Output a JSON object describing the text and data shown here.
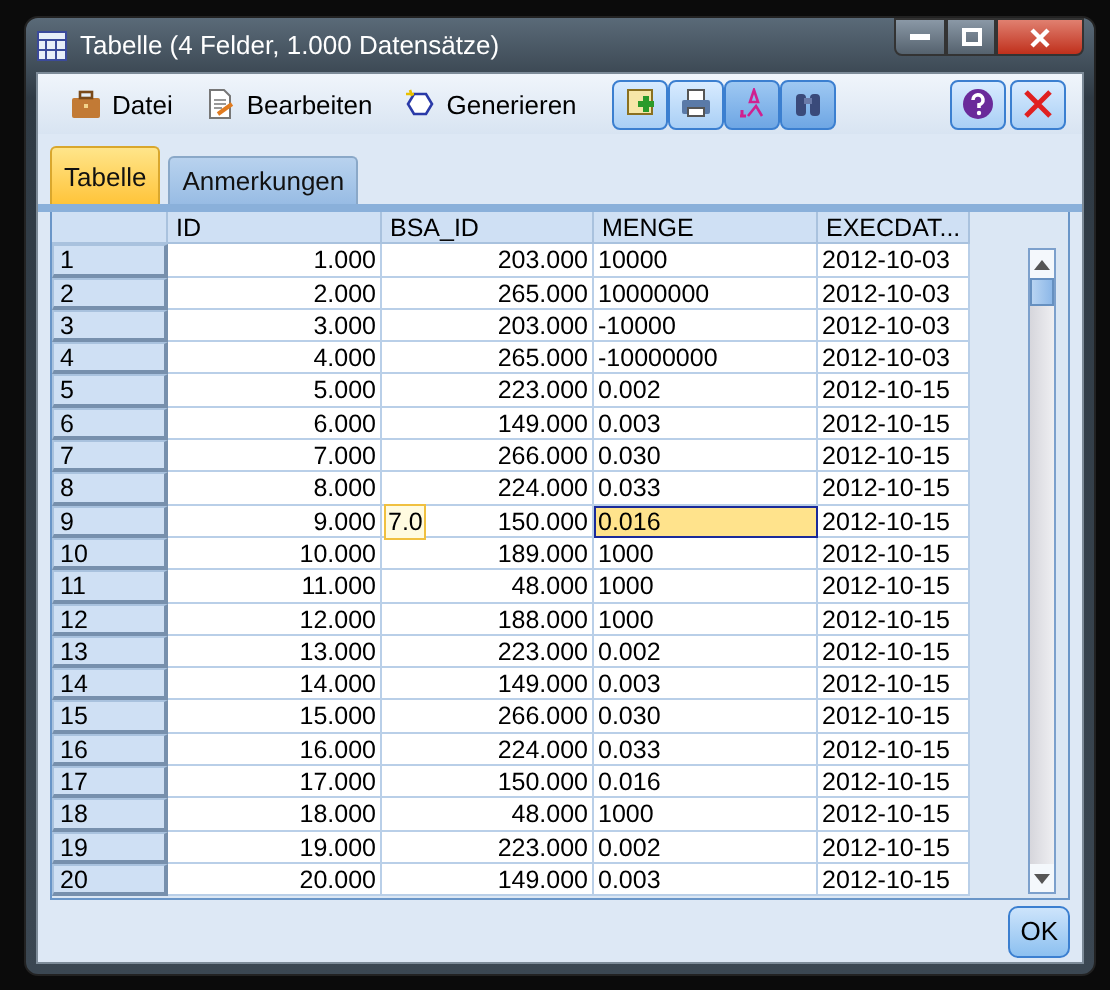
{
  "window": {
    "title": "Tabelle (4 Felder, 1.000 Datensätze)"
  },
  "menu": [
    {
      "label": "Datei"
    },
    {
      "label": "Bearbeiten"
    },
    {
      "label": "Generieren"
    }
  ],
  "tabs": [
    {
      "label": "Tabelle",
      "selected": true
    },
    {
      "label": "Anmerkungen",
      "selected": false
    }
  ],
  "table": {
    "columns": [
      "ID",
      "BSA_ID",
      "MENGE",
      "EXECDAT..."
    ],
    "rows": [
      {
        "row": "1",
        "cells": [
          "1.000",
          "203.000",
          "10000",
          "2012-10-03"
        ],
        "selected": false
      },
      {
        "row": "2",
        "cells": [
          "2.000",
          "265.000",
          "10000000",
          "2012-10-03"
        ],
        "selected": false
      },
      {
        "row": "3",
        "cells": [
          "3.000",
          "203.000",
          "-10000",
          "2012-10-03"
        ],
        "selected": false
      },
      {
        "row": "4",
        "cells": [
          "4.000",
          "265.000",
          "-10000000",
          "2012-10-03"
        ],
        "selected": false
      },
      {
        "row": "5",
        "cells": [
          "5.000",
          "223.000",
          "0.002",
          "2012-10-15"
        ],
        "selected": false
      },
      {
        "row": "6",
        "cells": [
          "6.000",
          "149.000",
          "0.003",
          "2012-10-15"
        ],
        "selected": false
      },
      {
        "row": "7",
        "cells": [
          "7.000",
          "266.000",
          "0.030",
          "2012-10-15"
        ],
        "selected": false
      },
      {
        "row": "8",
        "cells": [
          "8.000",
          "224.000",
          "0.033",
          "2012-10-15"
        ],
        "selected": false
      },
      {
        "row": "9",
        "cells": [
          "9.000",
          "150.000",
          "0.016",
          "2012-10-15"
        ],
        "selected": true
      },
      {
        "row": "10",
        "cells": [
          "10.000",
          "189.000",
          "1000",
          "2012-10-15"
        ],
        "selected": false
      },
      {
        "row": "11",
        "cells": [
          "11.000",
          "48.000",
          "1000",
          "2012-10-15"
        ],
        "selected": false
      },
      {
        "row": "12",
        "cells": [
          "12.000",
          "188.000",
          "1000",
          "2012-10-15"
        ],
        "selected": false
      },
      {
        "row": "13",
        "cells": [
          "13.000",
          "223.000",
          "0.002",
          "2012-10-15"
        ],
        "selected": false
      },
      {
        "row": "14",
        "cells": [
          "14.000",
          "149.000",
          "0.003",
          "2012-10-15"
        ],
        "selected": false
      },
      {
        "row": "15",
        "cells": [
          "15.000",
          "266.000",
          "0.030",
          "2012-10-15"
        ],
        "selected": false
      },
      {
        "row": "16",
        "cells": [
          "16.000",
          "224.000",
          "0.033",
          "2012-10-15"
        ],
        "selected": false
      },
      {
        "row": "17",
        "cells": [
          "17.000",
          "150.000",
          "0.016",
          "2012-10-15"
        ],
        "selected": false
      },
      {
        "row": "18",
        "cells": [
          "18.000",
          "48.000",
          "1000",
          "2012-10-15"
        ],
        "selected": false
      },
      {
        "row": "19",
        "cells": [
          "19.000",
          "223.000",
          "0.002",
          "2012-10-15"
        ],
        "selected": false
      },
      {
        "row": "20",
        "cells": [
          "20.000",
          "149.000",
          "0.003",
          "2012-10-15"
        ],
        "selected": false
      }
    ],
    "tooltip": "7.0"
  },
  "buttons": [
    "OK"
  ]
}
